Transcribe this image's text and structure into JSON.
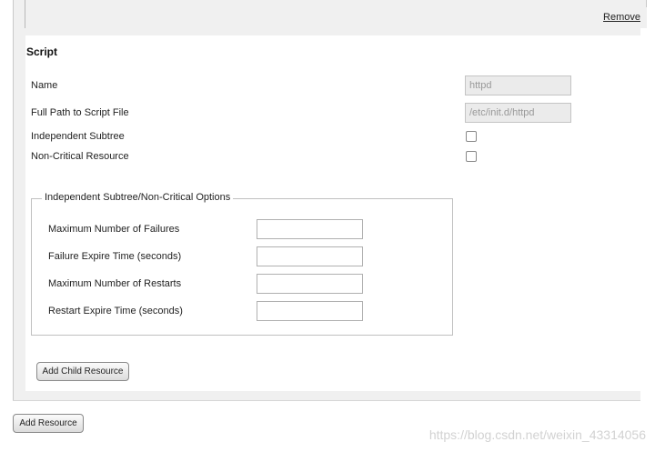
{
  "top": {
    "remove_label": "Remove"
  },
  "script": {
    "title": "Script",
    "fields": {
      "name_label": "Name",
      "name_value": "httpd",
      "path_label": "Full Path to Script File",
      "path_value": "/etc/init.d/httpd",
      "independent_label": "Independent Subtree",
      "independent_checked": false,
      "noncritical_label": "Non-Critical Resource",
      "noncritical_checked": false
    },
    "options": {
      "legend": "Independent Subtree/Non-Critical Options",
      "max_failures_label": "Maximum Number of Failures",
      "max_failures_value": "",
      "failure_expire_label": "Failure Expire Time (seconds)",
      "failure_expire_value": "",
      "max_restarts_label": "Maximum Number of Restarts",
      "max_restarts_value": "",
      "restart_expire_label": "Restart Expire Time (seconds)",
      "restart_expire_value": ""
    },
    "add_child_label": "Add Child Resource"
  },
  "add_resource_label": "Add Resource",
  "watermark": "https://blog.csdn.net/weixin_43314056"
}
